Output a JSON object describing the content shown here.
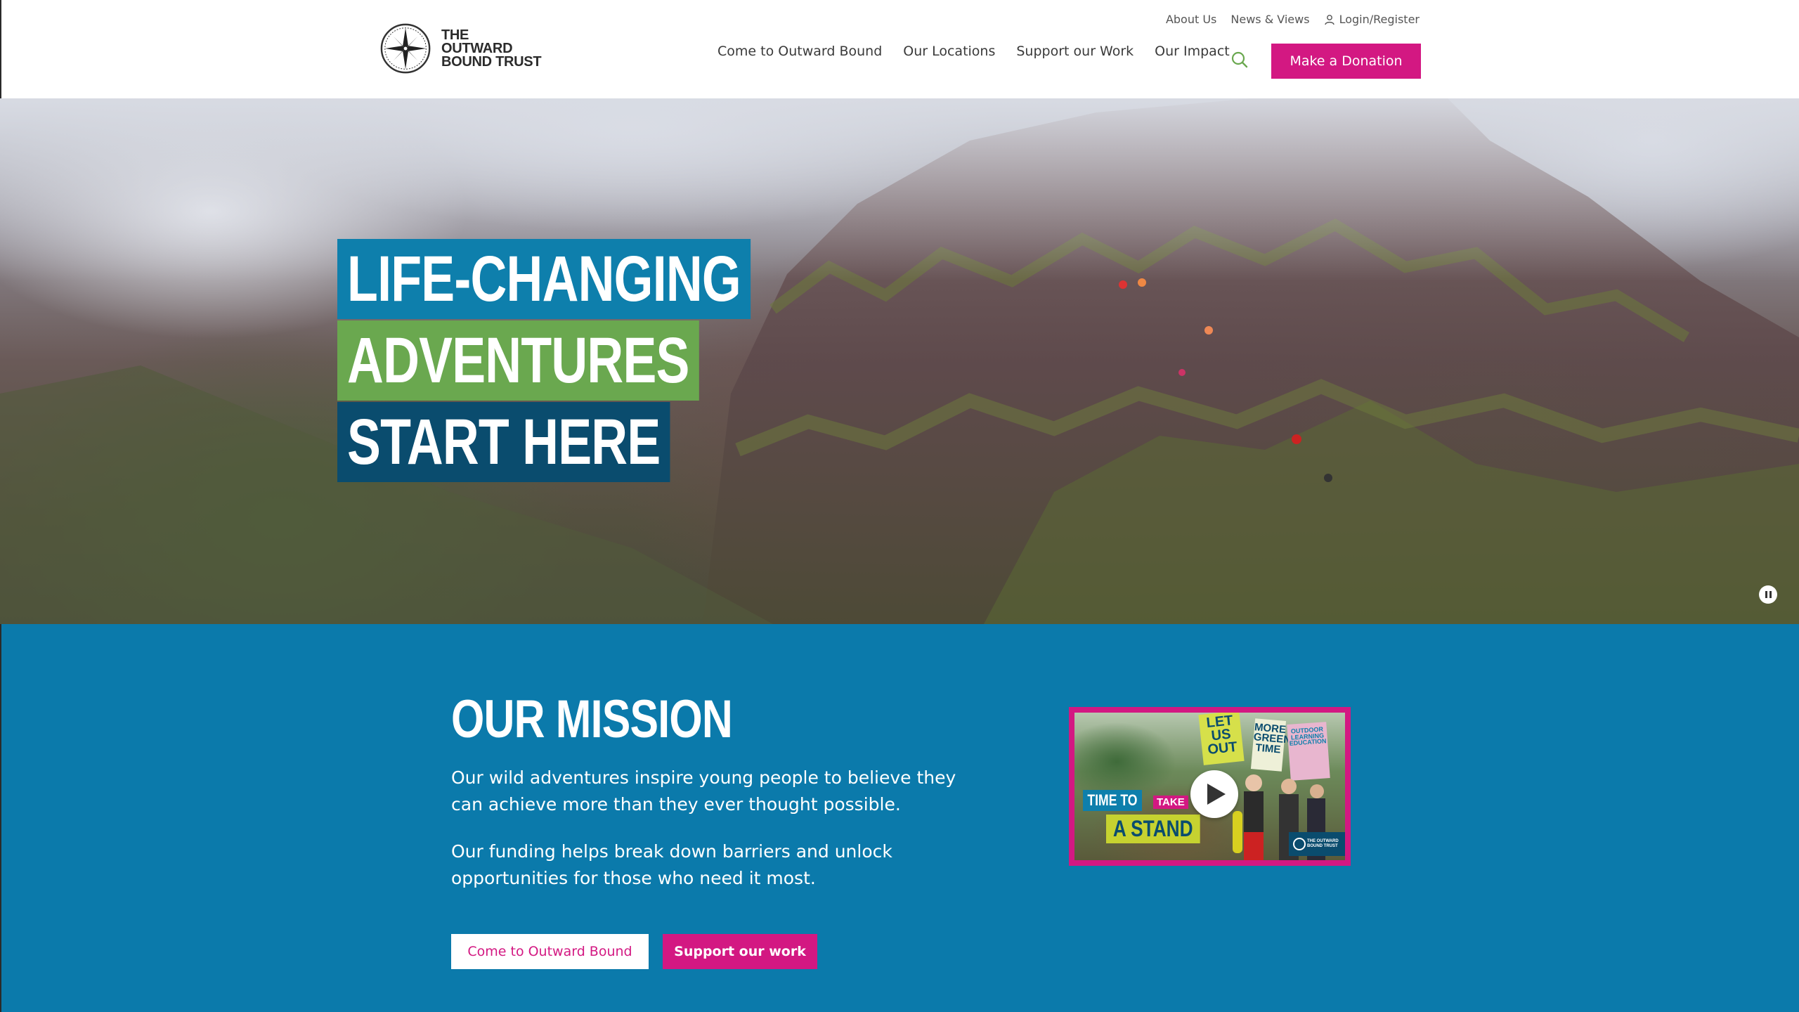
{
  "brand": {
    "name_lines": [
      "THE",
      "OUTWARD",
      "BOUND TRUST"
    ],
    "registered_mark": "®"
  },
  "utility_nav": {
    "about": "About Us",
    "news": "News & Views",
    "login": "Login/Register"
  },
  "main_nav": {
    "items": [
      "Come to Outward Bound",
      "Our Locations",
      "Support our Work",
      "Our Impact"
    ],
    "donate_label": "Make a Donation"
  },
  "hero": {
    "headline": [
      "LIFE-CHANGING",
      "ADVENTURES",
      "START HERE"
    ]
  },
  "mission": {
    "title": "OUR MISSION",
    "paragraph1": "Our wild adventures inspire young people to believe they can achieve more than they ever thought possible.",
    "paragraph2": "Our funding helps break down barriers and unlock opportunities for those who need it most.",
    "button_primary": "Come to Outward Bound",
    "button_secondary": "Support our work"
  },
  "video": {
    "caption_time": "TIME TO",
    "caption_take": "TAKE",
    "caption_stand": "A STAND",
    "sign1": "LET US OUT",
    "sign2": "MORE GREEN TIME",
    "sign3": "OUTDOOR LEARNING EDUCATION",
    "brand_small": "THE OUTWARD BOUND TRUST"
  },
  "colors": {
    "accent_pink": "#d31882",
    "blue": "#0e7fac",
    "green": "#6aa84f",
    "navy": "#0a4c6e",
    "mission_bg": "#0b7aab"
  },
  "icons": {
    "logo": "compass-rose-icon",
    "search": "search-icon",
    "user": "user-icon",
    "play": "play-icon",
    "pause": "pause-icon"
  }
}
